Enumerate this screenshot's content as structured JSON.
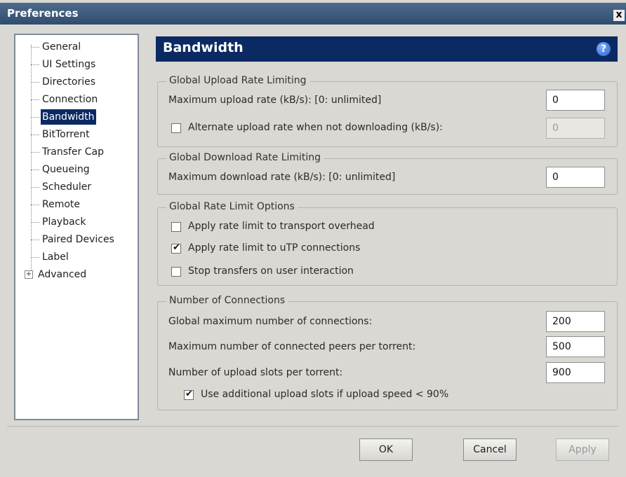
{
  "window": {
    "title": "Preferences",
    "close_label": "x"
  },
  "tree": {
    "items": [
      {
        "label": "General"
      },
      {
        "label": "UI Settings"
      },
      {
        "label": "Directories"
      },
      {
        "label": "Connection"
      },
      {
        "label": "Bandwidth",
        "selected": true
      },
      {
        "label": "BitTorrent"
      },
      {
        "label": "Transfer Cap"
      },
      {
        "label": "Queueing"
      },
      {
        "label": "Scheduler"
      },
      {
        "label": "Remote"
      },
      {
        "label": "Playback"
      },
      {
        "label": "Paired Devices"
      },
      {
        "label": "Label"
      },
      {
        "label": "Advanced",
        "expander": "+"
      }
    ]
  },
  "header": {
    "title": "Bandwidth",
    "help_label": "?"
  },
  "upload": {
    "legend": "Global Upload Rate Limiting",
    "max_label": "Maximum upload rate (kB/s): [0: unlimited]",
    "max_value": "0",
    "alt_label": "Alternate upload rate when not downloading (kB/s):",
    "alt_checked": false,
    "alt_value": "0"
  },
  "download": {
    "legend": "Global Download Rate Limiting",
    "max_label": "Maximum download rate (kB/s): [0: unlimited]",
    "max_value": "0"
  },
  "options": {
    "legend": "Global Rate Limit Options",
    "overhead_label": "Apply rate limit to transport overhead",
    "overhead_checked": false,
    "utp_label": "Apply rate limit to uTP connections",
    "utp_checked": true,
    "stop_label": "Stop transfers on user interaction",
    "stop_checked": false
  },
  "connections": {
    "legend": "Number of Connections",
    "global_label": "Global maximum number of connections:",
    "global_value": "200",
    "peers_label": "Maximum number of connected peers per torrent:",
    "peers_value": "500",
    "slots_label": "Number of upload slots per torrent:",
    "slots_value": "900",
    "additional_label": "Use additional upload slots if upload speed < 90%",
    "additional_checked": true
  },
  "buttons": {
    "ok": "OK",
    "cancel": "Cancel",
    "apply": "Apply"
  }
}
